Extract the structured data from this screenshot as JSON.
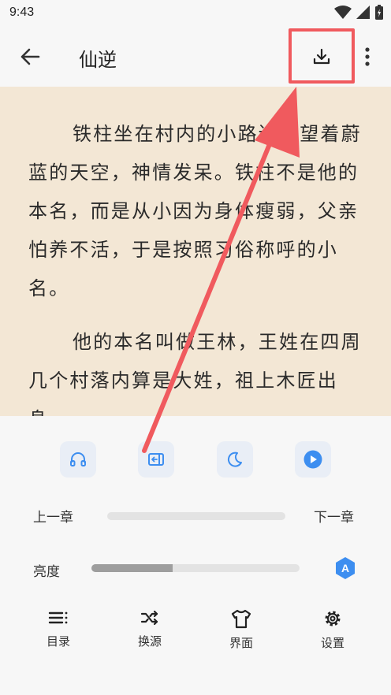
{
  "status": {
    "time": "9:43"
  },
  "appbar": {
    "title": "仙逆"
  },
  "reader": {
    "paragraphs": [
      "铁柱坐在村内的小路边，望着蔚蓝的天空，神情发呆。铁柱不是他的本名，而是从小因为身体瘦弱，父亲怕养不活，于是按照习俗称呼的小名。",
      "他的本名叫做王林，王姓在四周几个村落内算是大姓，祖上木匠出身。"
    ]
  },
  "quick_actions": [
    "headphones-icon",
    "exit-icon",
    "night-mode-icon",
    "play-icon"
  ],
  "chapter_nav": {
    "prev": "上一章",
    "next": "下一章"
  },
  "brightness": {
    "label": "亮度",
    "level": 0.39,
    "auto": "A"
  },
  "bottom_nav": {
    "catalog": "目录",
    "source": "换源",
    "interface": "界面",
    "settings": "设置"
  },
  "colors": {
    "accent": "#3d8ef0",
    "annotation": "#f05a5e",
    "reader_bg": "#f3e7d5"
  }
}
